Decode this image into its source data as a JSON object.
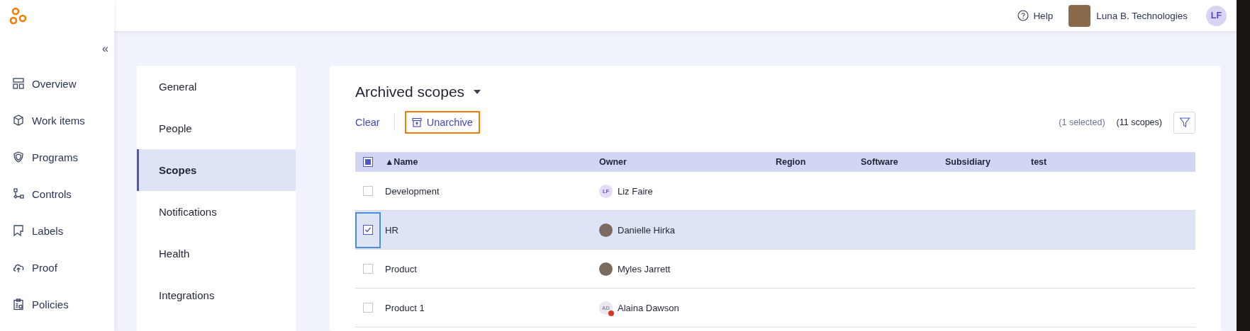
{
  "sidebar": {
    "collapse": "«",
    "items": [
      {
        "label": "Overview",
        "selected": false
      },
      {
        "label": "Work items",
        "selected": false
      },
      {
        "label": "Programs",
        "selected": false
      },
      {
        "label": "Controls",
        "selected": false
      },
      {
        "label": "Labels",
        "selected": false
      },
      {
        "label": "Proof",
        "selected": false
      },
      {
        "label": "Policies",
        "selected": false
      }
    ]
  },
  "header": {
    "help": "Help",
    "organization": "Luna B. Technologies",
    "user_initials": "LF"
  },
  "settings_menu": [
    {
      "label": "General",
      "selected": false
    },
    {
      "label": "People",
      "selected": false
    },
    {
      "label": "Scopes",
      "selected": true
    },
    {
      "label": "Notifications",
      "selected": false
    },
    {
      "label": "Health",
      "selected": false
    },
    {
      "label": "Integrations",
      "selected": false
    }
  ],
  "panel": {
    "title": "Archived scopes",
    "clear": "Clear",
    "unarchive": {
      "label": "Unarchive",
      "highlighted": true
    },
    "selected_count": "(1 selected)",
    "total_count": "(11 scopes)"
  },
  "table": {
    "select_all_indeterminate": true,
    "columns": [
      "▲Name",
      "Owner",
      "Region",
      "Software",
      "Subsidiary",
      "test"
    ],
    "rows": [
      {
        "name": "Development",
        "owner": "Liz Faire",
        "avatar": {
          "kind": "initials",
          "initials": "LF"
        },
        "selected": false,
        "focused": false
      },
      {
        "name": "HR",
        "owner": "Danielle Hirka",
        "avatar": {
          "kind": "photo"
        },
        "selected": true,
        "focused": true
      },
      {
        "name": "Product",
        "owner": "Myles Jarrett",
        "avatar": {
          "kind": "photo"
        },
        "selected": false,
        "focused": false
      },
      {
        "name": "Product 1",
        "owner": "Alaina Dawson",
        "avatar": {
          "kind": "blocked",
          "initials": "AD"
        },
        "selected": false,
        "focused": false
      }
    ]
  }
}
